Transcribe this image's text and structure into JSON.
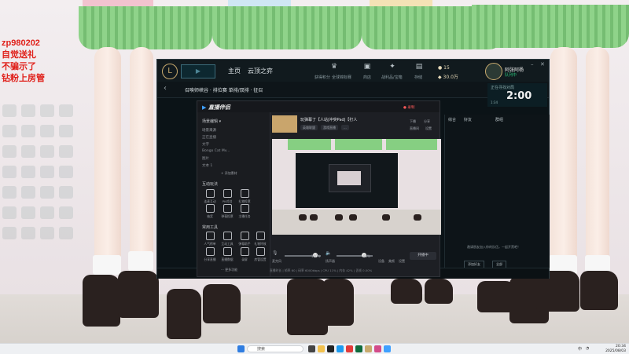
{
  "overlay": {
    "lines": [
      "zp980202",
      "自觉送礼",
      "不骗示了",
      "钻粉上房管"
    ],
    "color": "#e0201a"
  },
  "lol": {
    "nav": [
      "主页",
      "云顶之弈"
    ],
    "top_labels": [
      "获得积分",
      "全球锦标赛",
      "商店",
      "战利品/宝箱",
      "存储"
    ],
    "currency": {
      "be": "15",
      "rp": "30.0万"
    },
    "player": {
      "name": "阿张阿杨",
      "status": "队列中"
    },
    "window_controls": [
      "–",
      "✕"
    ],
    "queue_title": "召唤师峡谷 · 排位赛 单排/双排 · 征召",
    "queue_badge": "1",
    "timer": {
      "label": "正在寻找对局",
      "value": "2:00",
      "sub": "1:34"
    },
    "chat": {
      "tabs": [
        "综合",
        "好友",
        "群组"
      ],
      "message": "邀请朋友加入你的队伍，一起开黑吧！",
      "buttons": [
        "添加好友",
        "全部"
      ]
    }
  },
  "obs": {
    "logo": "直播伴侣",
    "record_indicator": "● 录制",
    "sidebar": {
      "scene_header": "场景编辑 ▾",
      "source_header": "场景来源",
      "sources": [
        "正在直播",
        "文字",
        "Bongo Cat Mv...",
        "图片",
        "文本 1"
      ],
      "add_source": "+ 添加素材",
      "interaction_header": "互动玩法",
      "interaction_tools": [
        "连麦互动",
        "PK对战",
        "礼物投票",
        "抽奖",
        "弹幕投票",
        "主播任务"
      ],
      "common_header": "常用工具",
      "common_tools": [
        "人气榜单",
        "互动工具",
        "弹幕助手",
        "礼物特效",
        "分享直播",
        "直播数据",
        "录屏",
        "房管设置"
      ],
      "more": "··· 更多功能"
    },
    "room": {
      "title": "玩弹幕了【人站|冲突Pad|【打人",
      "tags": [
        "英雄联盟",
        "游戏直播",
        "..."
      ],
      "actions": [
        "下播",
        "分享",
        "直播间",
        "设置"
      ]
    },
    "controls": {
      "mic_label": "麦克风",
      "mic_value": "100%",
      "speaker_label": "扬声器",
      "speaker_value": "85%",
      "mic_level": 0.85,
      "speaker_level": 0.75,
      "icons": [
        "设备",
        "美颜",
        "设置"
      ],
      "go_live": "开播中"
    },
    "status": "直播时长 | 帧率 60 | 码率 6000kbps | CPU 11% | 内存 42% | 丢帧 0.00%"
  },
  "taskbar": {
    "search_placeholder": "搜索",
    "time": "20:34",
    "date": "2025/08/03",
    "lang": "中"
  }
}
